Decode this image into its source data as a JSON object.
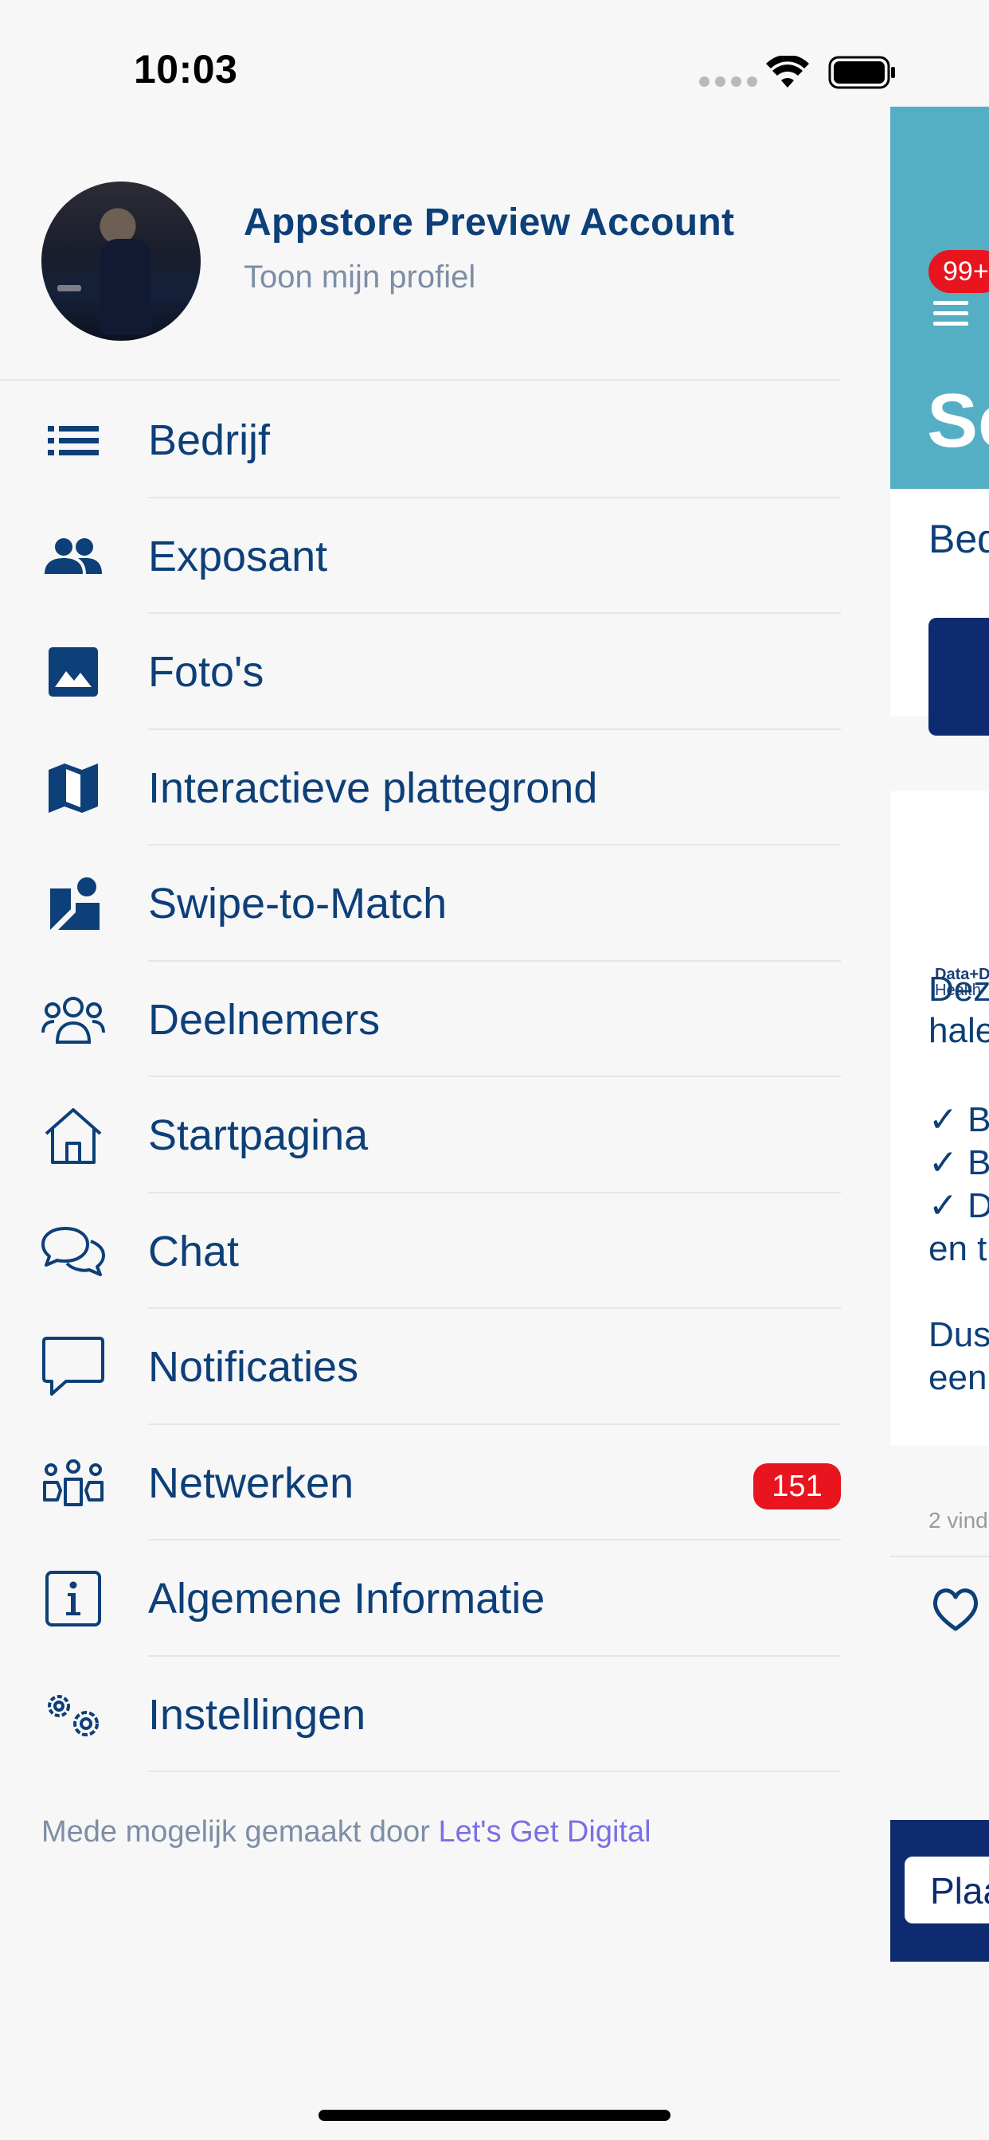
{
  "status_bar": {
    "time": "10:03"
  },
  "profile": {
    "name": "Appstore Preview Account",
    "subtitle": "Toon mijn profiel"
  },
  "menu": [
    {
      "label": "Bedrijf",
      "icon": "list-icon"
    },
    {
      "label": "Exposant",
      "icon": "people-icon"
    },
    {
      "label": "Foto's",
      "icon": "image-icon"
    },
    {
      "label": "Interactieve plattegrond",
      "icon": "map-icon"
    },
    {
      "label": "Swipe-to-Match",
      "icon": "swipe-match-icon"
    },
    {
      "label": "Deelnemers",
      "icon": "group-icon"
    },
    {
      "label": "Startpagina",
      "icon": "home-icon"
    },
    {
      "label": "Chat",
      "icon": "chat-bubbles-icon"
    },
    {
      "label": "Notificaties",
      "icon": "speech-bubble-icon"
    },
    {
      "label": "Netwerken",
      "icon": "network-people-icon",
      "badge": "151"
    },
    {
      "label": "Algemene Informatie",
      "icon": "info-icon"
    },
    {
      "label": "Instellingen",
      "icon": "gears-icon"
    }
  ],
  "footer": {
    "credit_prefix": "Mede mogelijk gemaakt door ",
    "credit_link": "Let's Get Digital"
  },
  "background_app": {
    "badge": "99+",
    "title": "Se",
    "tab": "Bed",
    "logo_top": "Data+D",
    "logo_bottom": "Health",
    "text_lines": [
      "Dez",
      "hale",
      "✓ B",
      "✓ B",
      "✓ D",
      "en t",
      "Dus",
      "een"
    ],
    "meta": "2 vind",
    "footer_button": "Plaa"
  },
  "colors": {
    "primary": "#0d3f78",
    "header_teal": "#55afc4",
    "badge_red": "#e8141e",
    "link": "#7b6fe4",
    "navy": "#0d2b6e"
  }
}
